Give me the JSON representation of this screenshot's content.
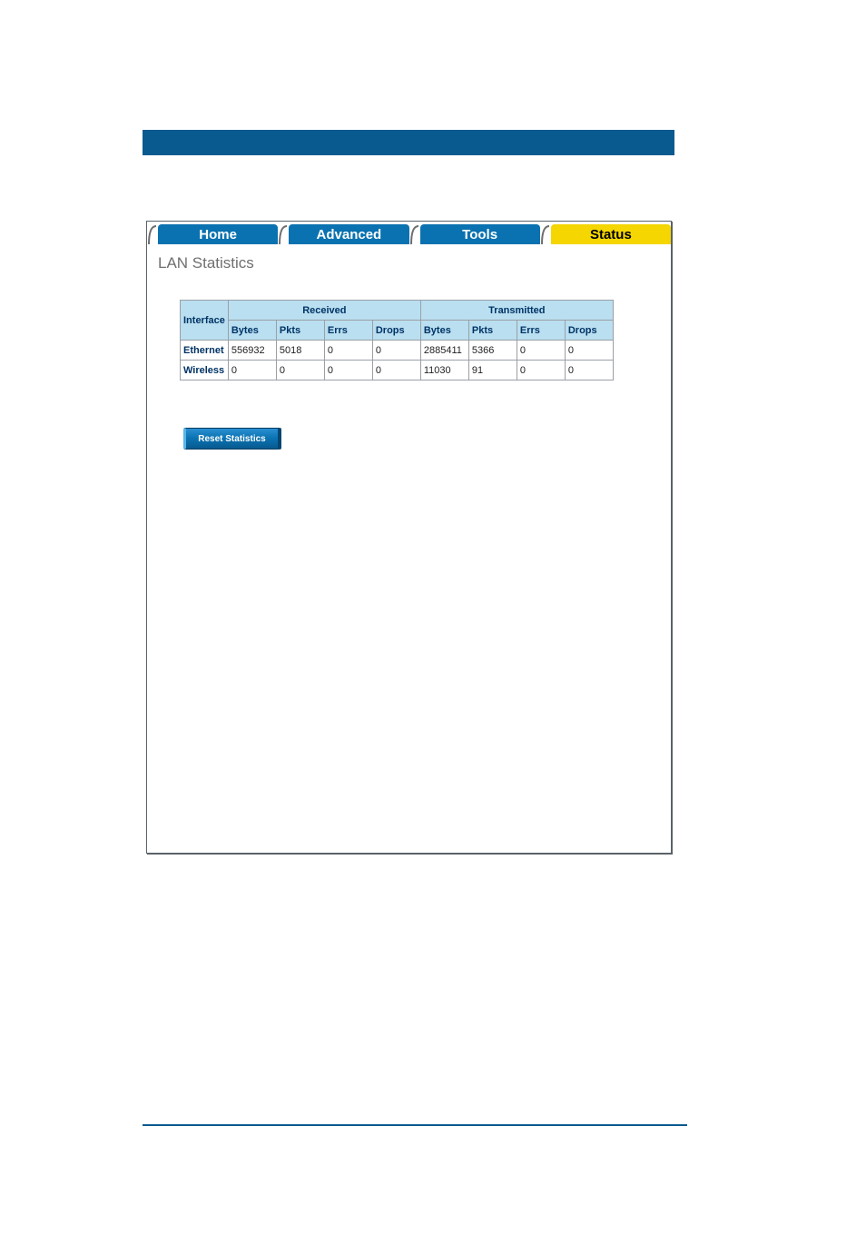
{
  "tabs": {
    "home": "Home",
    "advanced": "Advanced",
    "tools": "Tools",
    "status": "Status"
  },
  "page_title": "LAN Statistics",
  "table": {
    "headers": {
      "interface": "Interface",
      "received": "Received",
      "transmitted": "Transmitted",
      "bytes": "Bytes",
      "pkts": "Pkts",
      "errs": "Errs",
      "drops": "Drops"
    },
    "rows": [
      {
        "interface": "Ethernet",
        "rx_bytes": "556932",
        "rx_pkts": "5018",
        "rx_errs": "0",
        "rx_drops": "0",
        "tx_bytes": "2885411",
        "tx_pkts": "5366",
        "tx_errs": "0",
        "tx_drops": "0"
      },
      {
        "interface": "Wireless",
        "rx_bytes": "0",
        "rx_pkts": "0",
        "rx_errs": "0",
        "rx_drops": "0",
        "tx_bytes": "11030",
        "tx_pkts": "91",
        "tx_errs": "0",
        "tx_drops": "0"
      }
    ]
  },
  "reset_button": "Reset Statistics"
}
